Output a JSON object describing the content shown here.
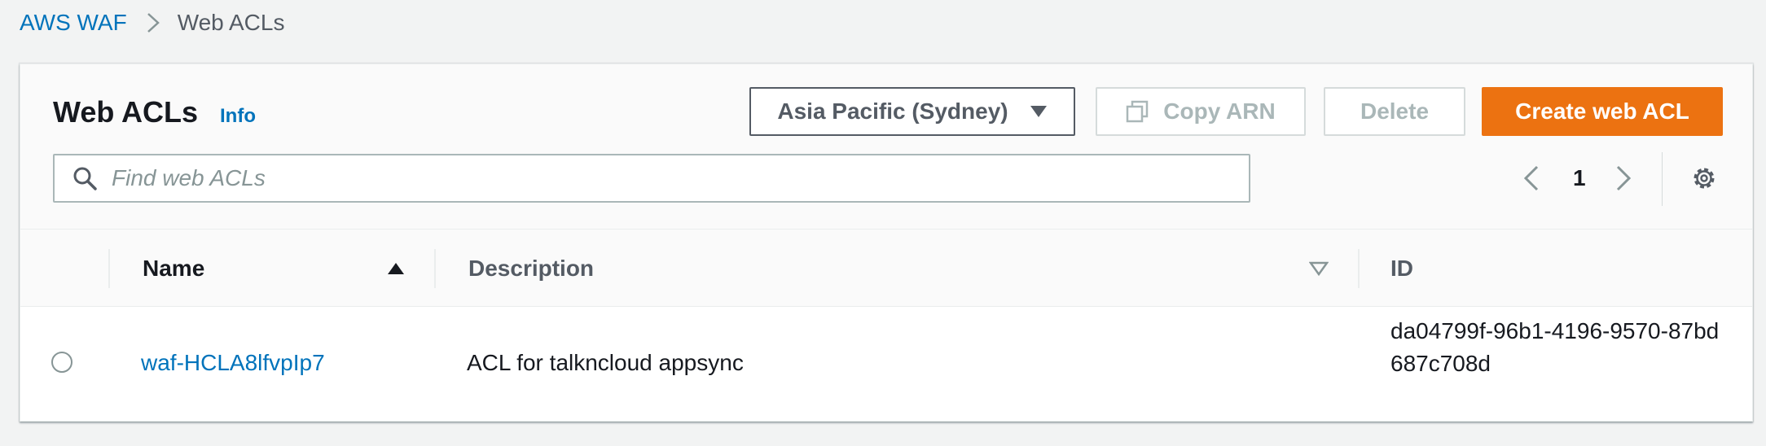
{
  "breadcrumb": {
    "parent": "AWS WAF",
    "current": "Web ACLs"
  },
  "header": {
    "title": "Web ACLs",
    "info": "Info",
    "region": "Asia Pacific (Sydney)",
    "copy_arn": "Copy ARN",
    "delete": "Delete",
    "create": "Create web ACL"
  },
  "search": {
    "placeholder": "Find web ACLs",
    "value": ""
  },
  "pagination": {
    "current_page": "1"
  },
  "table": {
    "columns": {
      "name": "Name",
      "description": "Description",
      "id": "ID"
    },
    "rows": [
      {
        "name": "waf-HCLA8lfvpIp7",
        "description": "ACL for talkncloud appsync",
        "id": "da04799f-96b1-4196-9570-87bd687c708d"
      }
    ]
  },
  "colors": {
    "link": "#0073bb",
    "primary_button": "#ec7211",
    "disabled_text": "#aab7b8",
    "background": "#f2f3f3"
  }
}
